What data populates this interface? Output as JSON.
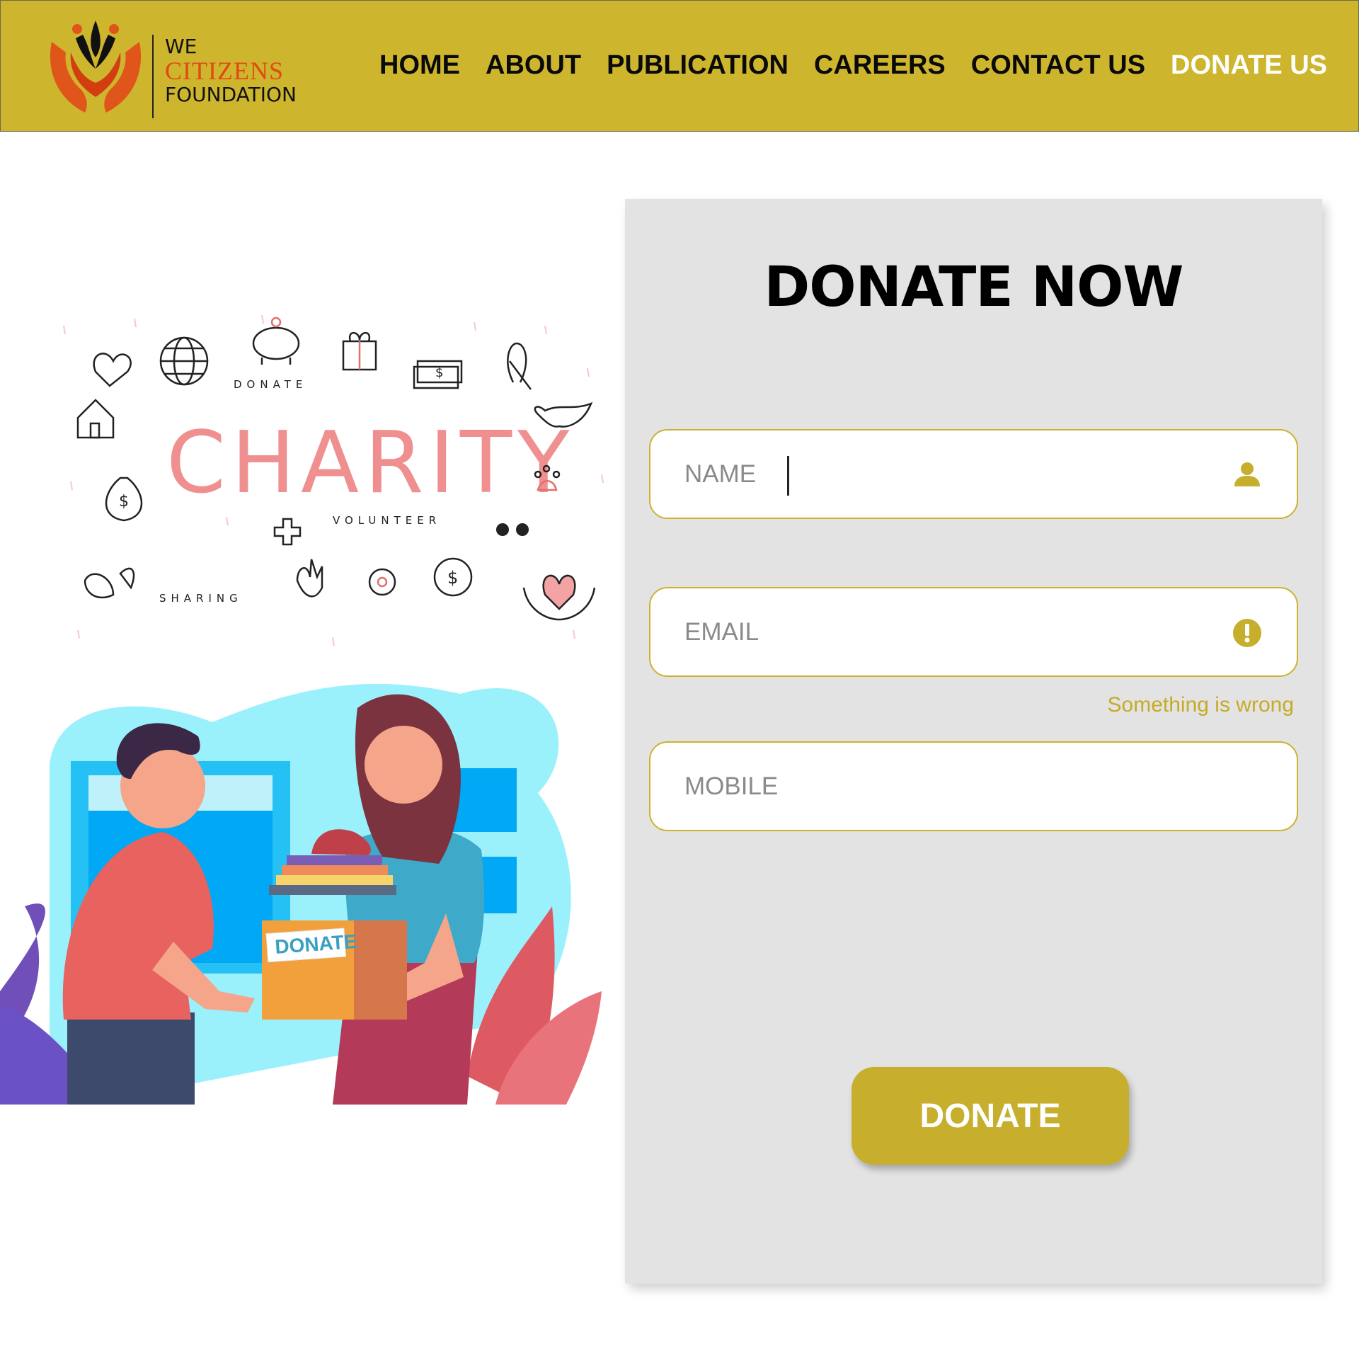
{
  "brand": {
    "line1": "WE",
    "line2": "CITIZENS",
    "line3": "FOUNDATION"
  },
  "nav": {
    "items": [
      {
        "label": "HOME"
      },
      {
        "label": "ABOUT"
      },
      {
        "label": "PUBLICATION"
      },
      {
        "label": "CAREERS"
      },
      {
        "label": "CONTACT US"
      },
      {
        "label": "DONATE US",
        "active": true
      }
    ]
  },
  "illustrations": {
    "charity": {
      "title": "CHARITY",
      "words": [
        "DONATE",
        "VOLUNTEER",
        "SHARING"
      ]
    },
    "donation_box_label": "DONATE"
  },
  "form": {
    "title": "DONATE NOW",
    "name": {
      "placeholder": "NAME",
      "value": "",
      "icon": "user-icon"
    },
    "email": {
      "placeholder": "EMAIL",
      "value": "",
      "icon": "alert-icon",
      "error": "Something is wrong"
    },
    "mobile": {
      "placeholder": "MOBILE",
      "value": ""
    },
    "submit_label": "DONATE"
  },
  "colors": {
    "header_bg": "#ceb52e",
    "accent": "#c7ae2c",
    "panel_bg": "#e3e3e3",
    "nav_active": "#ffffff",
    "brand_red": "#e04a13"
  }
}
